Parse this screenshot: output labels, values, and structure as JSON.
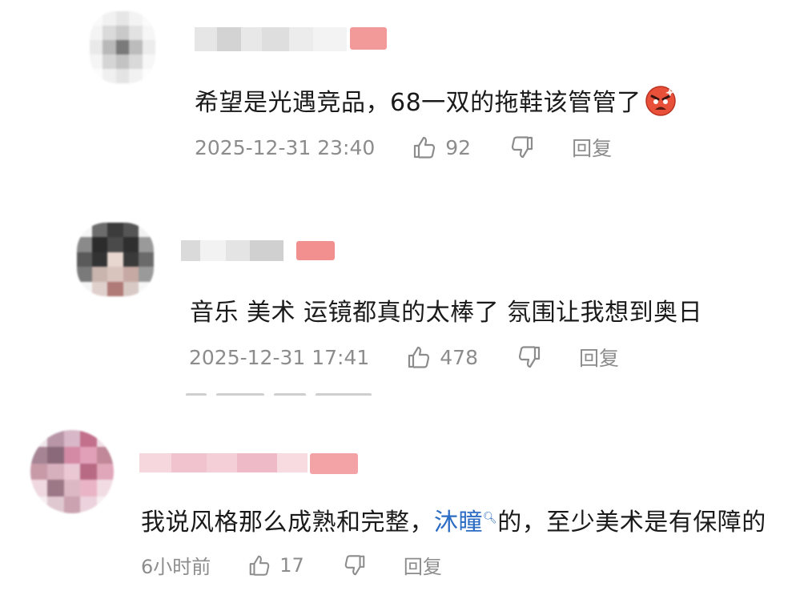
{
  "comments": [
    {
      "text": "希望是光遇竞品，68一双的拖鞋该管管了",
      "emoji": "angry-face-emoji",
      "time": "2025-12-31 23:40",
      "likes": "92",
      "reply_label": "回复"
    },
    {
      "text": "音乐 美术 运镜都真的太棒了 氛围让我想到奥日",
      "time": "2025-12-31 17:41",
      "likes": "478",
      "reply_label": "回复"
    },
    {
      "text_before": "我说风格那么成熟和完整，",
      "link": "沐瞳",
      "text_after": "的，至少美术是有保障的",
      "time": "6小时前",
      "likes": "17",
      "reply_label": "回复"
    }
  ],
  "colors": {
    "text": "#1a1a1a",
    "meta": "#8c8c8c",
    "link": "#2b6cc4",
    "badge": "#f08a8a"
  }
}
